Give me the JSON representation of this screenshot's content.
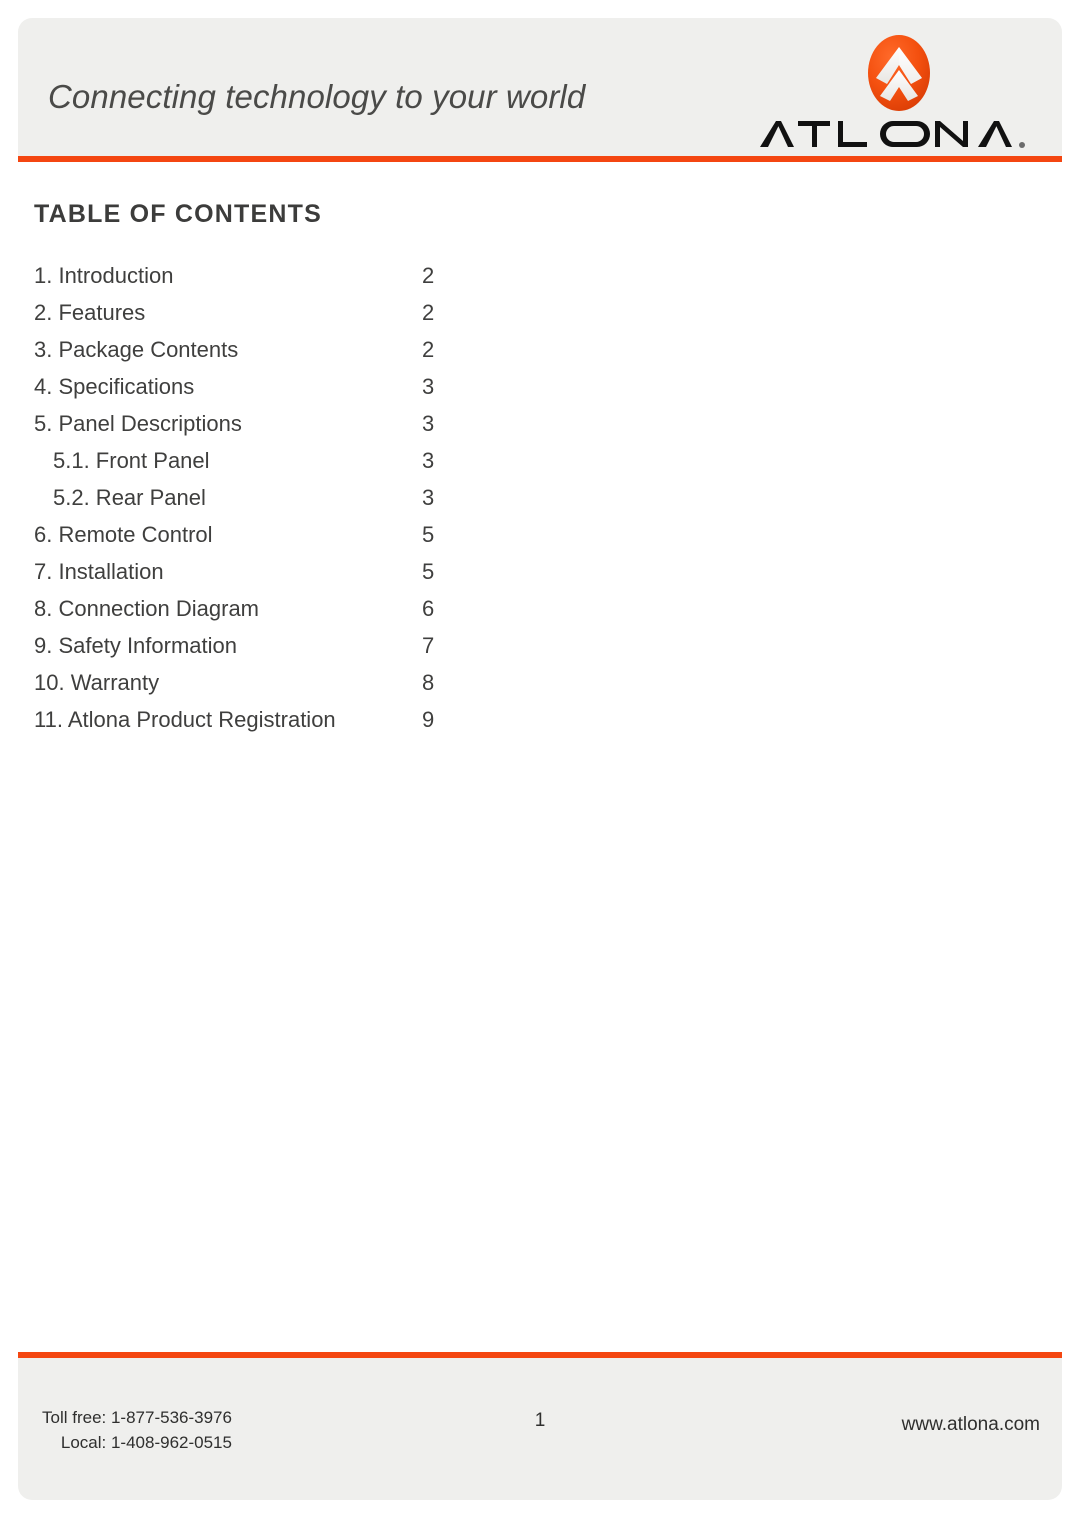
{
  "header": {
    "tagline": "Connecting technology to your world",
    "logo": {
      "mark_name": "atlona-logo-mark",
      "wordmark_text": "ATLONA.",
      "brand_color": "#f44611"
    }
  },
  "theme": {
    "accent_rule_color": "#f44611",
    "band_background": "#efefed",
    "page_background": "#ffffff",
    "body_text_color": "#3f3f3e",
    "heading_text_color": "#3c3c3b"
  },
  "main": {
    "heading": "TABLE OF CONTENTS",
    "toc": [
      {
        "label": "1. Introduction",
        "page": "2",
        "level": 1
      },
      {
        "label": "2. Features",
        "page": "2",
        "level": 1
      },
      {
        "label": "3. Package Contents",
        "page": "2",
        "level": 1
      },
      {
        "label": "4. Specifications",
        "page": "3",
        "level": 1
      },
      {
        "label": "5. Panel Descriptions",
        "page": "3",
        "level": 1
      },
      {
        "label": "5.1. Front Panel",
        "page": "3",
        "level": 2
      },
      {
        "label": "5.2. Rear Panel",
        "page": "3",
        "level": 2
      },
      {
        "label": "6. Remote Control",
        "page": "5",
        "level": 1
      },
      {
        "label": "7. Installation",
        "page": "5",
        "level": 1
      },
      {
        "label": "8. Connection Diagram",
        "page": "6",
        "level": 1
      },
      {
        "label": "9. Safety Information",
        "page": "7",
        "level": 1
      },
      {
        "label": "10. Warranty",
        "page": "8",
        "level": 1
      },
      {
        "label": "11. Atlona Product Registration",
        "page": "9",
        "level": 1
      }
    ]
  },
  "footer": {
    "toll_free_line": "Toll free: 1-877-536-3976",
    "local_line": "Local: 1-408-962-0515",
    "page_number": "1",
    "website": "www.atlona.com"
  }
}
